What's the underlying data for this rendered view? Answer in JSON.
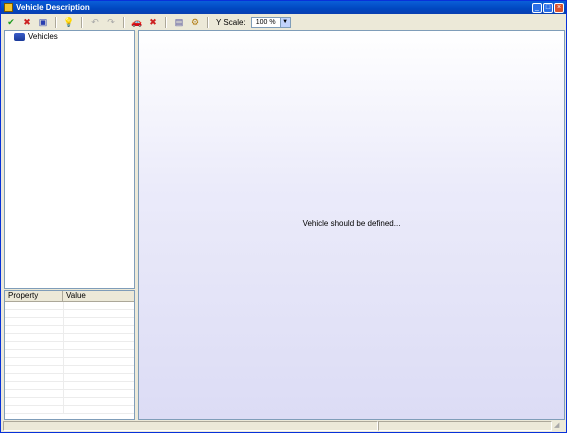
{
  "window": {
    "title": "Vehicle Description"
  },
  "toolbar": {
    "buttons": [
      {
        "name": "ok",
        "icon": "checkmark-icon",
        "glyph": "✔",
        "color": "#1a9a1a",
        "enabled": true
      },
      {
        "name": "cancel",
        "icon": "x-icon",
        "glyph": "✖",
        "color": "#cc2020",
        "enabled": true
      },
      {
        "name": "save",
        "icon": "floppy-icon",
        "glyph": "▣",
        "color": "#2a3fb0",
        "enabled": true
      },
      {
        "name": "help",
        "icon": "lightbulb-icon",
        "glyph": "💡",
        "color": "#d8a010",
        "enabled": true
      },
      {
        "name": "undo",
        "icon": "undo-icon",
        "glyph": "↶",
        "color": "#a8a8a8",
        "enabled": false
      },
      {
        "name": "redo",
        "icon": "redo-icon",
        "glyph": "↷",
        "color": "#a8a8a8",
        "enabled": false
      },
      {
        "name": "add-vehicle",
        "icon": "vehicle-icon",
        "glyph": "🚗",
        "color": "#3a5cc8",
        "enabled": true
      },
      {
        "name": "delete-vehicle",
        "icon": "delete-x-icon",
        "glyph": "✖",
        "color": "#cc2020",
        "enabled": true
      },
      {
        "name": "document",
        "icon": "document-icon",
        "glyph": "▤",
        "color": "#4a4a9a",
        "enabled": true
      },
      {
        "name": "tools",
        "icon": "tools-icon",
        "glyph": "⚙",
        "color": "#b07a10",
        "enabled": true
      }
    ],
    "yscale_label": "Y Scale:",
    "yscale_value": "100 %"
  },
  "tree": {
    "root_label": "Vehicles"
  },
  "properties": {
    "col_property": "Property",
    "col_value": "Value"
  },
  "main": {
    "message": "Vehicle should be defined..."
  }
}
